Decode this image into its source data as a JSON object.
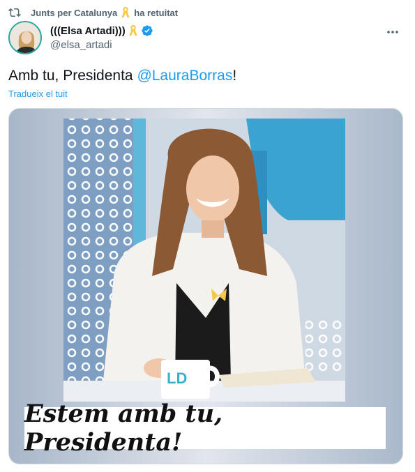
{
  "retweet": {
    "account": "Junts per Catalunya",
    "action": "ha retuitat"
  },
  "author": {
    "display_name": "(((Elsa Artadi)))",
    "handle": "@elsa_artadi"
  },
  "tweet": {
    "text_before": "Amb tu, Presidenta ",
    "mention": "@LauraBorras",
    "text_after": "!",
    "translate_label": "Tradueix el tuit"
  },
  "media": {
    "mug_text": "LD",
    "caption": "Estem amb tu, Presidenta!"
  },
  "colors": {
    "accent": "#1d9bf0",
    "verified": "#1d9bf0",
    "ribbon": "#f2c94c"
  },
  "icons": {
    "retweet": "retweet-icon",
    "ribbon": "yellow-ribbon-icon",
    "verified": "verified-badge-icon",
    "more": "more-icon"
  }
}
